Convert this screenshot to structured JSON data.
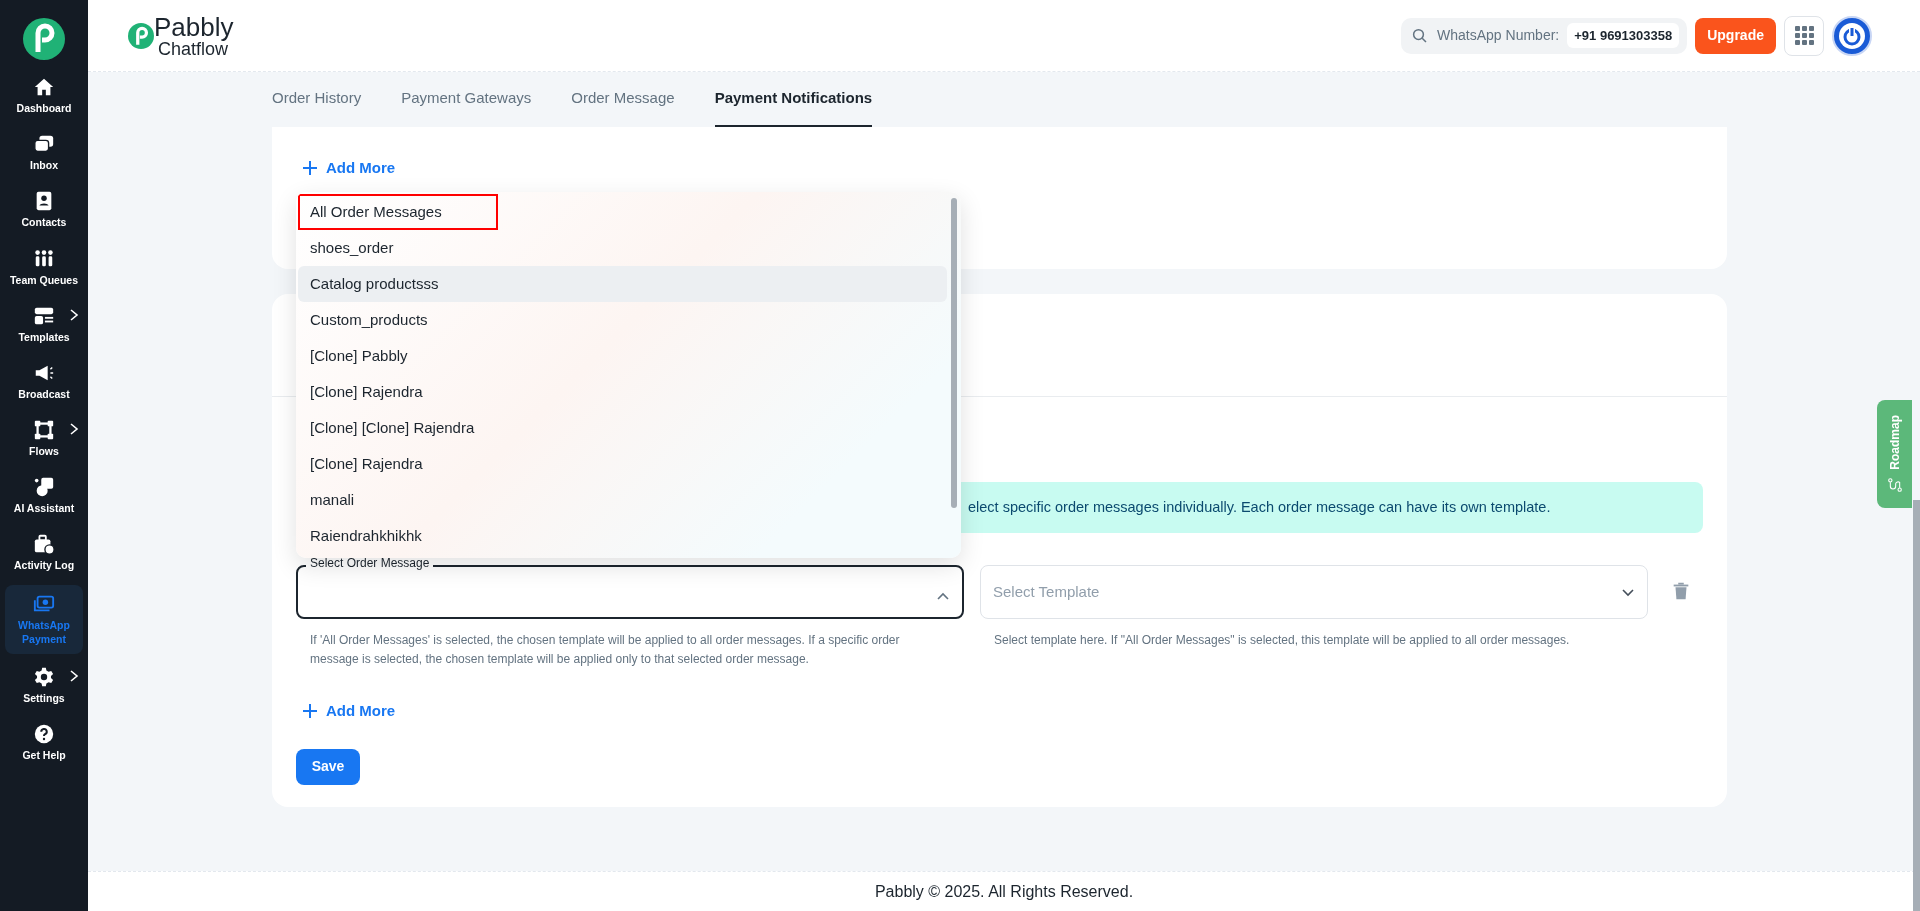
{
  "sidebar": {
    "items": [
      {
        "label": "Dashboard",
        "selected": false,
        "submenu": false
      },
      {
        "label": "Inbox",
        "selected": false,
        "submenu": false
      },
      {
        "label": "Contacts",
        "selected": false,
        "submenu": false
      },
      {
        "label": "Team Queues",
        "selected": false,
        "submenu": false
      },
      {
        "label": "Templates",
        "selected": false,
        "submenu": true
      },
      {
        "label": "Broadcast",
        "selected": false,
        "submenu": false
      },
      {
        "label": "Flows",
        "selected": false,
        "submenu": true
      },
      {
        "label": "AI Assistant",
        "selected": false,
        "submenu": false
      },
      {
        "label": "Activity Log",
        "selected": false,
        "submenu": false
      },
      {
        "label": "WhatsApp Payment",
        "selected": true,
        "submenu": false
      },
      {
        "label": "Settings",
        "selected": false,
        "submenu": true
      },
      {
        "label": "Get Help",
        "selected": false,
        "submenu": false
      }
    ]
  },
  "header": {
    "logo_text": "Pabbly",
    "logo_subtext": "Chatflow",
    "number_label": "WhatsApp Number:",
    "number_value": "+91 9691303358",
    "upgrade_button": "Upgrade"
  },
  "tabs": [
    {
      "label": "Order History",
      "selected": false
    },
    {
      "label": "Payment Gateways",
      "selected": false
    },
    {
      "label": "Order Message",
      "selected": false
    },
    {
      "label": "Payment Notifications",
      "selected": true
    }
  ],
  "top_add_more": "Add More",
  "dropdown": {
    "options": [
      {
        "label": "All Order Messages",
        "highlighted": false,
        "outlined": true
      },
      {
        "label": "shoes_order",
        "highlighted": false,
        "outlined": false
      },
      {
        "label": "Catalog productsss",
        "highlighted": true,
        "outlined": false
      },
      {
        "label": "Custom_products",
        "highlighted": false,
        "outlined": false
      },
      {
        "label": "[Clone] Pabbly",
        "highlighted": false,
        "outlined": false
      },
      {
        "label": "[Clone] Rajendra",
        "highlighted": false,
        "outlined": false
      },
      {
        "label": "[Clone] [Clone] Rajendra",
        "highlighted": false,
        "outlined": false
      },
      {
        "label": "[Clone] Rajendra",
        "highlighted": false,
        "outlined": false
      },
      {
        "label": "manali",
        "highlighted": false,
        "outlined": false
      },
      {
        "label": "Raiendrahkhikhk",
        "highlighted": false,
        "outlined": false
      }
    ]
  },
  "info_alert": "elect specific order messages individually. Each order message can have its own template.",
  "order_select": {
    "label": "Select Order Message",
    "expanded": true,
    "help": "If 'All Order Messages' is selected, the chosen template will be applied to all order messages. If a specific order message is selected, the chosen template will be applied only to that selected order message."
  },
  "template_select": {
    "placeholder": "Select Template",
    "help": "Select template here. If \"All Order Messages\" is selected, this template will be applied to all order messages."
  },
  "bottom_add_more": "Add More",
  "save_button": "Save",
  "roadmap_tab": "Roadmap",
  "footer": "Pabbly © 2025. All Rights Reserved."
}
